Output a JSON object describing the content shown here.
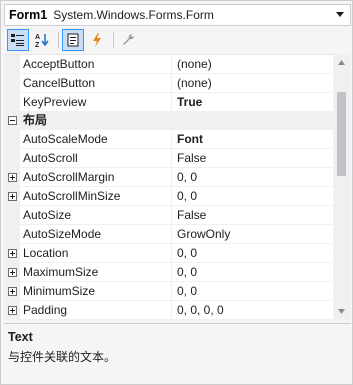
{
  "header": {
    "object_name": "Form1",
    "object_type": "System.Windows.Forms.Form"
  },
  "toolbar": {
    "buttons": [
      {
        "icon": "categorized-icon",
        "active": true
      },
      {
        "icon": "alphabetical-icon",
        "active": false
      },
      {
        "icon": "properties-icon",
        "active": true
      },
      {
        "icon": "events-icon",
        "active": false
      },
      {
        "icon": "property-pages-icon",
        "active": false
      }
    ]
  },
  "grid": {
    "rows": [
      {
        "kind": "prop",
        "name": "AcceptButton",
        "value": "(none)",
        "bold": false,
        "expander": false
      },
      {
        "kind": "prop",
        "name": "CancelButton",
        "value": "(none)",
        "bold": false,
        "expander": false
      },
      {
        "kind": "prop",
        "name": "KeyPreview",
        "value": "True",
        "bold": true,
        "expander": false
      },
      {
        "kind": "category",
        "name": "布局"
      },
      {
        "kind": "prop",
        "name": "AutoScaleMode",
        "value": "Font",
        "bold": true,
        "expander": false
      },
      {
        "kind": "prop",
        "name": "AutoScroll",
        "value": "False",
        "bold": false,
        "expander": false
      },
      {
        "kind": "prop",
        "name": "AutoScrollMargin",
        "value": "0, 0",
        "bold": false,
        "expander": true
      },
      {
        "kind": "prop",
        "name": "AutoScrollMinSize",
        "value": "0, 0",
        "bold": false,
        "expander": true
      },
      {
        "kind": "prop",
        "name": "AutoSize",
        "value": "False",
        "bold": false,
        "expander": false
      },
      {
        "kind": "prop",
        "name": "AutoSizeMode",
        "value": "GrowOnly",
        "bold": false,
        "expander": false
      },
      {
        "kind": "prop",
        "name": "Location",
        "value": "0, 0",
        "bold": false,
        "expander": true
      },
      {
        "kind": "prop",
        "name": "MaximumSize",
        "value": "0, 0",
        "bold": false,
        "expander": true
      },
      {
        "kind": "prop",
        "name": "MinimumSize",
        "value": "0, 0",
        "bold": false,
        "expander": true
      },
      {
        "kind": "prop",
        "name": "Padding",
        "value": "0, 0, 0, 0",
        "bold": false,
        "expander": true
      }
    ]
  },
  "description": {
    "title": "Text",
    "text": "与控件关联的文本。"
  }
}
